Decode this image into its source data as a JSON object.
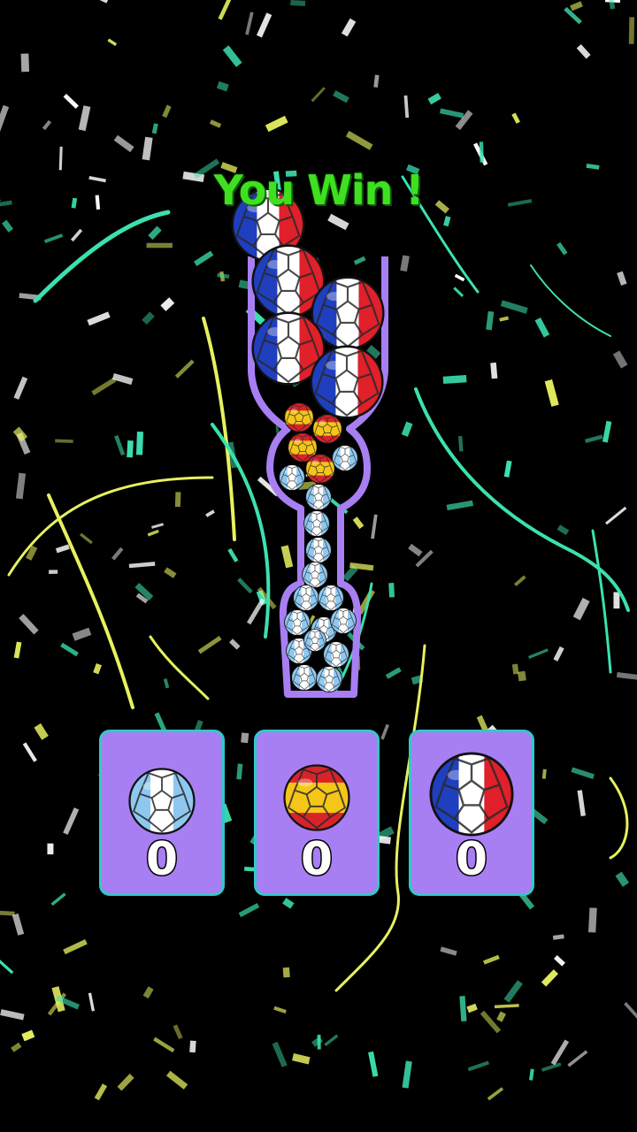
{
  "banner": {
    "text": "You Win !"
  },
  "colors": {
    "background": "#000000",
    "win_text": "#3fe01f",
    "tube_outline": "#a77ff2",
    "card_fill": "#a77ff2",
    "card_border": "#32c8c8",
    "confetti": [
      "#3ce0b0",
      "#e8f060",
      "#ffffff"
    ]
  },
  "tube": {
    "ball_groups": [
      {
        "flag": "france",
        "count": 6
      },
      {
        "flag": "spain",
        "count": 4
      },
      {
        "flag": "argentina",
        "count": 18
      }
    ]
  },
  "cards": [
    {
      "flag": "argentina",
      "icon": "argentina-ball-icon",
      "count": "0"
    },
    {
      "flag": "spain",
      "icon": "spain-ball-icon",
      "count": "0"
    },
    {
      "flag": "france",
      "icon": "france-ball-icon",
      "count": "0"
    }
  ]
}
